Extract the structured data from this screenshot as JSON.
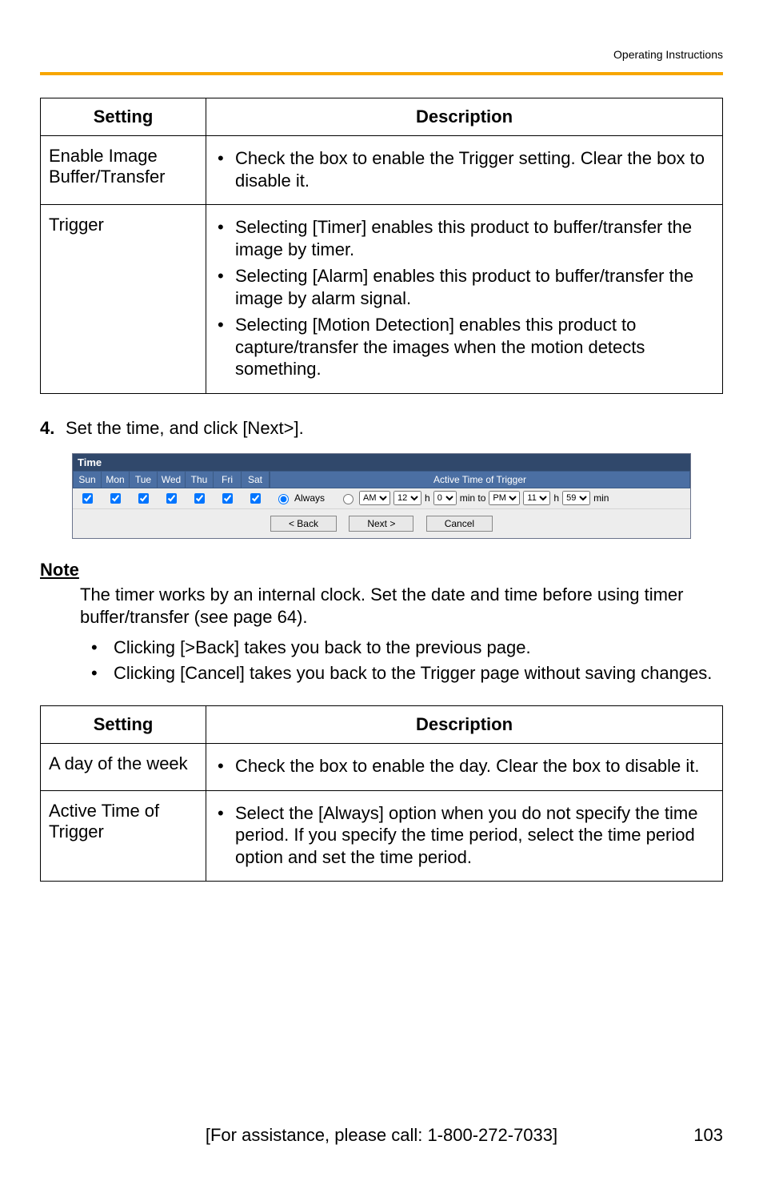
{
  "header": {
    "label": "Operating Instructions"
  },
  "table1": {
    "head": {
      "setting": "Setting",
      "description": "Description"
    },
    "rows": [
      {
        "label": "Enable Image Buffer/Transfer",
        "bullets": [
          "Check the box to enable the Trigger setting. Clear the box to disable it."
        ]
      },
      {
        "label": "Trigger",
        "bullets": [
          "Selecting [Timer] enables this product to buffer/transfer the image by timer.",
          "Selecting [Alarm] enables this product to buffer/transfer the image by alarm signal.",
          "Selecting [Motion Detection] enables this product to capture/transfer the images when the motion detects something."
        ]
      }
    ]
  },
  "step": {
    "num": "4.",
    "text": "Set the time, and click [Next>]."
  },
  "time_widget": {
    "title": "Time",
    "days": [
      "Sun",
      "Mon",
      "Tue",
      "Wed",
      "Thu",
      "Fri",
      "Sat"
    ],
    "active_label": "Active Time of Trigger",
    "always": "Always",
    "ampm1": "AM",
    "h1": "12",
    "m1": "0",
    "minto": "min to",
    "ampm2": "PM",
    "h2": "11",
    "m2": "59",
    "minend": "min",
    "h_label": "h",
    "buttons": {
      "back": "< Back",
      "next": "Next >",
      "cancel": "Cancel"
    }
  },
  "note": {
    "heading": "Note",
    "body": "The timer works by an internal clock. Set the date and time before using timer buffer/transfer (see page 64).",
    "items": [
      "Clicking [>Back] takes you back to the previous page.",
      "Clicking [Cancel] takes you back to the Trigger page without saving changes."
    ]
  },
  "table2": {
    "head": {
      "setting": "Setting",
      "description": "Description"
    },
    "rows": [
      {
        "label": "A day of the week",
        "bullets": [
          "Check the box to enable the day. Clear the box to disable it."
        ]
      },
      {
        "label": "Active Time of Trigger",
        "bullets": [
          "Select the [Always] option when you do not specify the time period. If you specify the time period, select the time period option and set the time period."
        ]
      }
    ]
  },
  "footer": {
    "center": "[For assistance, please call: 1-800-272-7033]",
    "page": "103"
  }
}
